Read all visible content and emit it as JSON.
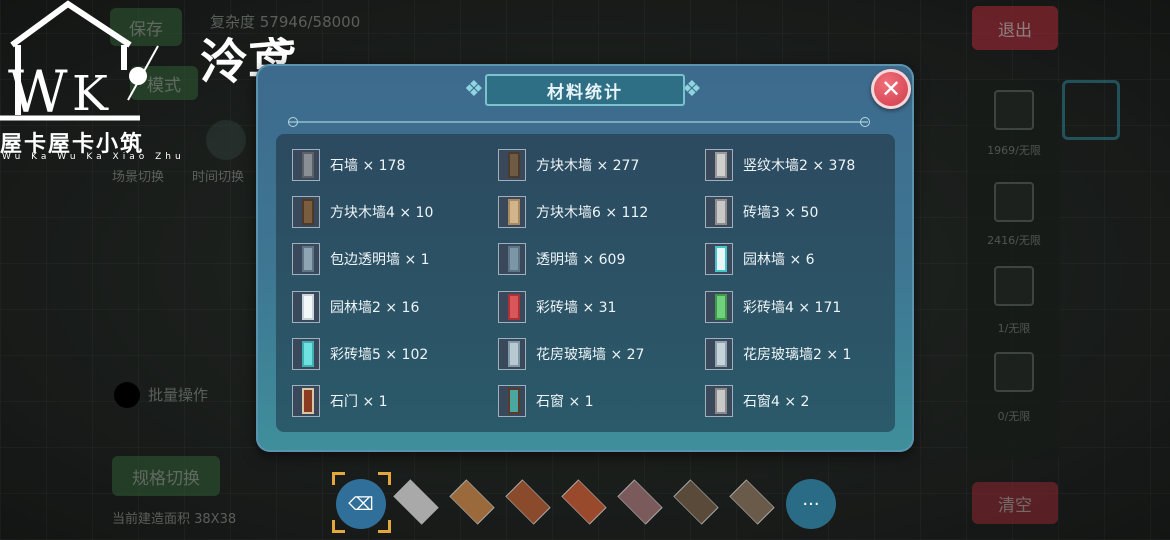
{
  "hud": {
    "save_label": "保存",
    "complexity": "复杂度 57946/58000",
    "mode_label": "模式",
    "scene_switch": "场景切换",
    "time_switch": "时间切换",
    "batch_label": "批量操作",
    "spec_switch": "规格切换",
    "area_label": "当前建造面积 38X38",
    "exit_label": "退出",
    "clear_label": "清空"
  },
  "logo": {
    "name": "泠鸢",
    "subtitle": "屋卡屋卡小筑",
    "romanized": "Wu Ka Wu Ka Xiao Zhu"
  },
  "right_panel": {
    "slots": [
      {
        "icon": "wall-block-icon",
        "text": "1969/无限"
      },
      {
        "icon": "floor-grid-icon",
        "text": "2416/无限"
      },
      {
        "icon": "window-icon",
        "text": "1/无限"
      },
      {
        "icon": "door-icon",
        "text": "0/无限"
      }
    ]
  },
  "dialog": {
    "title": "材料统计",
    "close": "✕",
    "items": [
      {
        "label": "石墙 × 178",
        "color": "#8a8f95",
        "edge": "#5c6166"
      },
      {
        "label": "方块木墙 × 277",
        "color": "#6e5a45",
        "edge": "#4b3b2c"
      },
      {
        "label": "竖纹木墙2 × 378",
        "color": "#cfcfcf",
        "edge": "#9a9a9a"
      },
      {
        "label": "方块木墙4 × 10",
        "color": "#7a5d3e",
        "edge": "#4f3a25"
      },
      {
        "label": "方块木墙6 × 112",
        "color": "#d2b48a",
        "edge": "#a88a62"
      },
      {
        "label": "砖墙3 × 50",
        "color": "#c8c8c8",
        "edge": "#8e8e8e"
      },
      {
        "label": "包边透明墙 × 1",
        "color": "#8fa5b3",
        "edge": "#5d7585"
      },
      {
        "label": "透明墙 × 609",
        "color": "#7b96a6",
        "edge": "#5d7585"
      },
      {
        "label": "园林墙 × 6",
        "color": "#e9f6f8",
        "edge": "#45c4c9"
      },
      {
        "label": "园林墙2 × 16",
        "color": "#f4f7f8",
        "edge": "#c9d4da"
      },
      {
        "label": "彩砖墙 × 31",
        "color": "#d9565a",
        "edge": "#a93337"
      },
      {
        "label": "彩砖墙4 × 171",
        "color": "#6fd17c",
        "edge": "#3f9a4c"
      },
      {
        "label": "彩砖墙5 × 102",
        "color": "#6fe1e0",
        "edge": "#3fb1b3"
      },
      {
        "label": "花房玻璃墙 × 27",
        "color": "#b9c9d2",
        "edge": "#8198a6"
      },
      {
        "label": "花房玻璃墙2 × 1",
        "color": "#c7d3da",
        "edge": "#8fa3af"
      },
      {
        "label": "石门 × 1",
        "color": "#8a3b22",
        "edge": "#d7c7a3"
      },
      {
        "label": "石窗 × 1",
        "color": "#4aa6a0",
        "edge": "#5a3a28"
      },
      {
        "label": "石窗4 × 2",
        "color": "#c9c9c9",
        "edge": "#8a8a8a"
      }
    ]
  },
  "bottom_bar": {
    "tiles": [
      {
        "icon": "eraser-icon",
        "color": "#2f6f99"
      },
      {
        "icon": "gray-tile-icon",
        "color": "#a9a9a9"
      },
      {
        "icon": "tile-icon",
        "color": "#9a6a3c"
      },
      {
        "icon": "tile-icon",
        "color": "#8a4a2c"
      },
      {
        "icon": "tile-icon",
        "color": "#9a4a2c"
      },
      {
        "icon": "tile-icon",
        "color": "#7a5a5a"
      },
      {
        "icon": "tile-icon",
        "color": "#5a4a3a"
      },
      {
        "icon": "tile-icon",
        "color": "#6a5a4a"
      }
    ],
    "more": "···"
  }
}
